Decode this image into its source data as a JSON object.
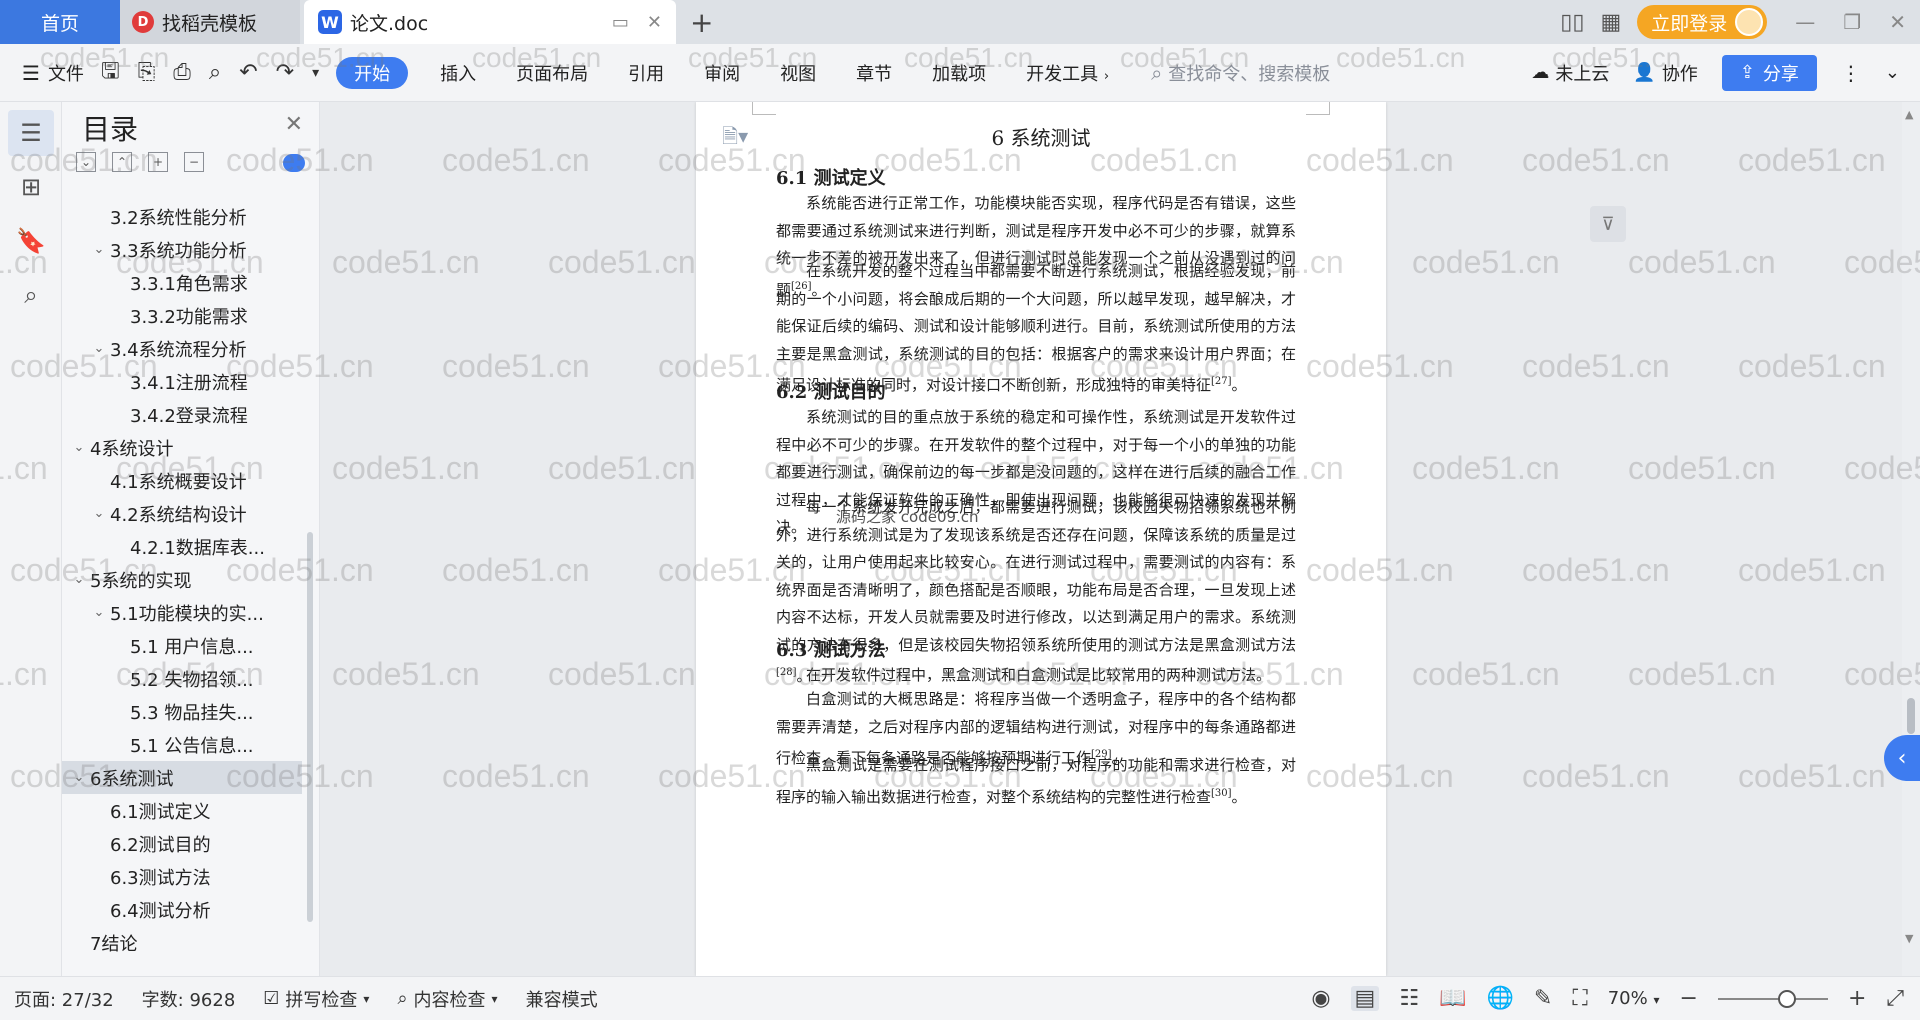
{
  "titlebar": {
    "tabs": [
      {
        "label": "首页"
      },
      {
        "label": "找稻壳模板"
      },
      {
        "label": "论文.doc"
      }
    ],
    "login_label": "立即登录"
  },
  "toolbar": {
    "file_label": "文件",
    "menus": [
      "开始",
      "插入",
      "页面布局",
      "引用",
      "审阅",
      "视图",
      "章节",
      "加载项",
      "开发工具"
    ],
    "search_placeholder": "查找命令、搜索模板",
    "cloud_label": "未上云",
    "collab_label": "协作",
    "share_label": "分享"
  },
  "toc": {
    "title": "目录",
    "items": [
      {
        "label": "3.2系统性能分析",
        "level": 2,
        "caret": ""
      },
      {
        "label": "3.3系统功能分析",
        "level": 2,
        "caret": "v"
      },
      {
        "label": "3.3.1角色需求",
        "level": 3,
        "caret": ""
      },
      {
        "label": "3.3.2功能需求",
        "level": 3,
        "caret": ""
      },
      {
        "label": "3.4系统流程分析",
        "level": 2,
        "caret": "v"
      },
      {
        "label": "3.4.1注册流程",
        "level": 3,
        "caret": ""
      },
      {
        "label": "3.4.2登录流程",
        "level": 3,
        "caret": ""
      },
      {
        "label": "4系统设计",
        "level": 1,
        "caret": "v"
      },
      {
        "label": "4.1系统概要设计",
        "level": 2,
        "caret": ""
      },
      {
        "label": "4.2系统结构设计",
        "level": 2,
        "caret": "v"
      },
      {
        "label": "4.2.1数据库表...",
        "level": 3,
        "caret": ""
      },
      {
        "label": "5系统的实现",
        "level": 1,
        "caret": "v"
      },
      {
        "label": "5.1功能模块的实...",
        "level": 2,
        "caret": "v"
      },
      {
        "label": "5.1 用户信息...",
        "level": 3,
        "caret": ""
      },
      {
        "label": "5.2  失物招领...",
        "level": 3,
        "caret": ""
      },
      {
        "label": "5.3 物品挂失...",
        "level": 3,
        "caret": ""
      },
      {
        "label": "5.1 公告信息...",
        "level": 3,
        "caret": ""
      },
      {
        "label": "6系统测试",
        "level": 1,
        "caret": "v",
        "selected": true
      },
      {
        "label": "6.1测试定义",
        "level": 2,
        "caret": ""
      },
      {
        "label": "6.2测试目的",
        "level": 2,
        "caret": ""
      },
      {
        "label": "6.3测试方法",
        "level": 2,
        "caret": ""
      },
      {
        "label": "6.4测试分析",
        "level": 2,
        "caret": ""
      },
      {
        "label": "7结论",
        "level": 1,
        "caret": ""
      }
    ]
  },
  "document": {
    "chapter": "6  系统测试",
    "stamp": "源码之家  code09.cn",
    "sections": [
      {
        "heading": "6.1  测试定义",
        "paras": [
          {
            "text": "系统能否进行正常工作，功能模块能否实现，程序代码是否有错误，这些都需要通过系统测试来进行判断，测试是程序开发中必不可少的步骤，就算系统一步不差的被开发出来了，但进行测试时总能发现一个之前从没遇到过的问题",
            "ref": "[26]",
            "tail": "。"
          },
          {
            "text": "在系统开发的整个过程当中都需要不断进行系统测试，根据经验发现，前期的一个小问题，将会酿成后期的一个大问题，所以越早发现，越早解决，才能保证后续的编码、测试和设计能够顺利进行。目前，系统测试所使用的方法主要是黑盒测试，系统测试的目的包括：根据客户的需求来设计用户界面；在满足设计标准的同时，对设计接口不断创新，形成独特的审美特征",
            "ref": "[27]",
            "tail": "。"
          }
        ]
      },
      {
        "heading": "6.2  测试目的",
        "paras": [
          {
            "text": "系统测试的目的重点放于系统的稳定和可操作性，系统测试是开发软件过程中必不可少的步骤。在开发软件的整个过程中，对于每一个小的单独的功能都要进行测试，确保前边的每一步都是没问题的，这样在进行后续的融合工作过程中，才能保证软件的正确性，即使出现问题，也能够很可快速的发现并解决。",
            "ref": "",
            "tail": ""
          },
          {
            "text": "每一个系统发开完成之后，都需要进行测试，该校园失物招领系统也不例外，进行系统测试是为了发现该系统是否还存在问题，保障该系统的质量是过关的，让用户使用起来比较安心。在进行测试过程中，需要测试的内容有：系统界面是否清晰明了，颜色搭配是否顺眼，功能布局是否合理，一旦发现上述内容不达标，开发人员就需要及时进行修改，以达到满足用户的需求。系统测试的方法有很多，但是该校园失物招领系统所使用的测试方法是黑盒测试方法",
            "ref": "[28]",
            "tail": "。"
          }
        ]
      },
      {
        "heading": "6.3  测试方法",
        "paras": [
          {
            "text": "在开发软件过程中，黑盒测试和白盒测试是比较常用的两种测试方法。",
            "ref": "",
            "tail": ""
          },
          {
            "text": "白盒测试的大概思路是：将程序当做一个透明盒子，程序中的各个结构都需要弄清楚，之后对程序内部的逻辑结构进行测试，对程序中的每条通路都进行检查，看下每条通路是否能够按预期进行工作",
            "ref": "[29]",
            "tail": "。"
          },
          {
            "text": "黑盒测试是需要在测试程序接口之前，对程序的功能和需求进行检查，对程序的输入输出数据进行检查，对整个系统结构的完整性进行检查",
            "ref": "[30]",
            "tail": "。"
          }
        ]
      }
    ]
  },
  "statusbar": {
    "page": "页面: 27/32",
    "words": "字数: 9628",
    "spell": "拼写检查",
    "content": "内容检查",
    "compat": "兼容模式",
    "zoom": "70%"
  },
  "watermark": "code51.cn"
}
